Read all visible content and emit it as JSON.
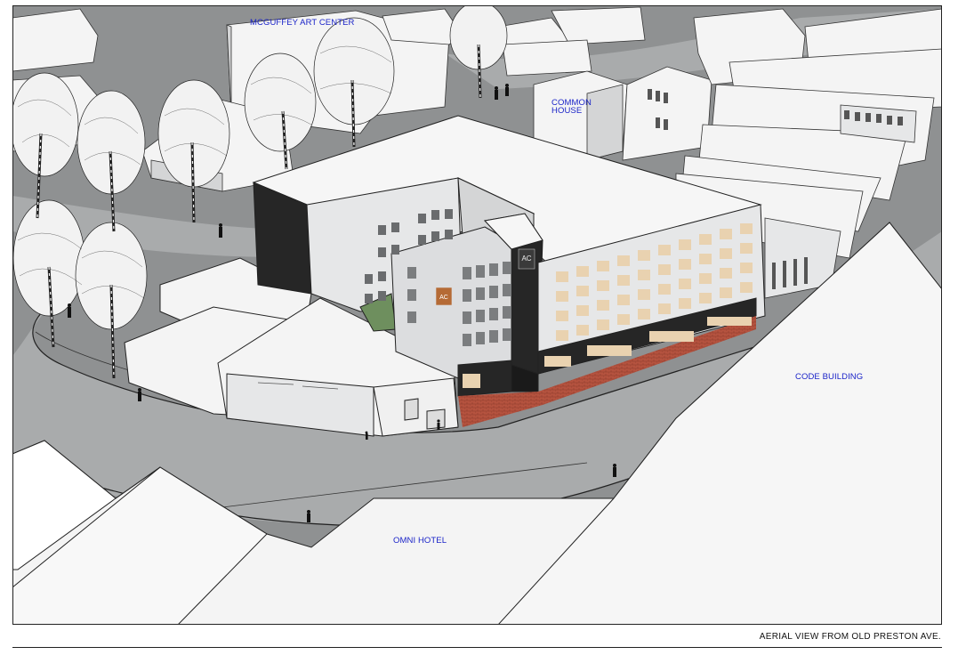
{
  "labels": {
    "mcguffey_art_center": "MCGUFFEY ART CENTER",
    "common_house_line1": "COMMON",
    "common_house_line2": "HOUSE",
    "code_building": "CODE BUILDING",
    "omni_hotel": "OMNI HOTEL"
  },
  "caption": "AERIAL VIEW FROM OLD PRESTON AVE.",
  "colors": {
    "ground": "#8f9192",
    "road": "#a9abac",
    "building_white": "#f4f4f4",
    "building_shade": "#d4d5d6",
    "facade_light": "#e6e7e8",
    "window_glow": "#e9d2b0",
    "dark_accent": "#262626",
    "brick_paving": "#b5533f",
    "label_blue": "#1a23c8"
  },
  "icons": [
    "tree-icon",
    "pedestrian-icon",
    "hotel-sign-icon"
  ]
}
